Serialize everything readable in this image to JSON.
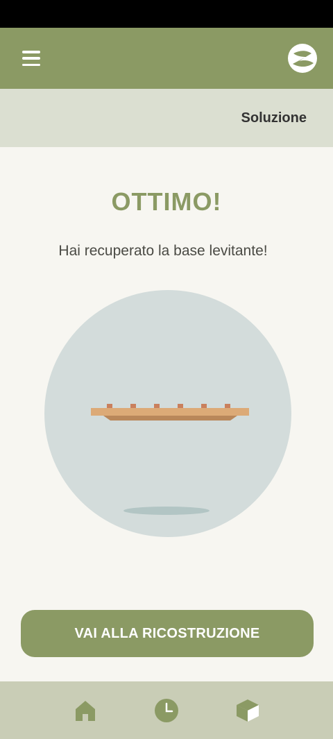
{
  "header": {
    "menu_icon": "hamburger-menu-icon",
    "logo_icon": "app-logo-icon"
  },
  "subheader": {
    "title": "Soluzione"
  },
  "main": {
    "headline": "OTTIMO!",
    "message": "Hai recuperato la base levitante!",
    "illustration": "levitating-base"
  },
  "cta": {
    "label": "VAI ALLA RICOSTRUZIONE"
  },
  "bottom_nav": {
    "items": [
      {
        "icon": "home-icon"
      },
      {
        "icon": "clock-icon"
      },
      {
        "icon": "cube-icon"
      }
    ]
  },
  "colors": {
    "primary": "#8b9a64",
    "subheader_bg": "#dbdfd1",
    "nav_bg": "#c9cdb6",
    "background": "#f7f6f1",
    "circle": "#d3dcdb",
    "platform": "#dcaa77"
  }
}
